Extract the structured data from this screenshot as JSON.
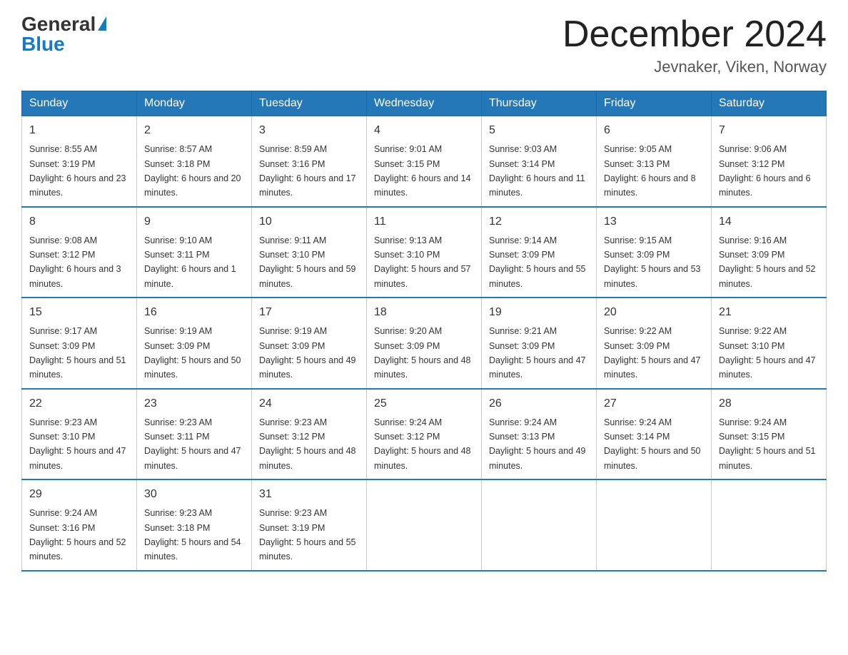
{
  "header": {
    "logo_general": "General",
    "logo_blue": "Blue",
    "month_title": "December 2024",
    "location": "Jevnaker, Viken, Norway"
  },
  "days_of_week": [
    "Sunday",
    "Monday",
    "Tuesday",
    "Wednesday",
    "Thursday",
    "Friday",
    "Saturday"
  ],
  "weeks": [
    [
      {
        "day": "1",
        "sunrise": "8:55 AM",
        "sunset": "3:19 PM",
        "daylight": "6 hours and 23 minutes."
      },
      {
        "day": "2",
        "sunrise": "8:57 AM",
        "sunset": "3:18 PM",
        "daylight": "6 hours and 20 minutes."
      },
      {
        "day": "3",
        "sunrise": "8:59 AM",
        "sunset": "3:16 PM",
        "daylight": "6 hours and 17 minutes."
      },
      {
        "day": "4",
        "sunrise": "9:01 AM",
        "sunset": "3:15 PM",
        "daylight": "6 hours and 14 minutes."
      },
      {
        "day": "5",
        "sunrise": "9:03 AM",
        "sunset": "3:14 PM",
        "daylight": "6 hours and 11 minutes."
      },
      {
        "day": "6",
        "sunrise": "9:05 AM",
        "sunset": "3:13 PM",
        "daylight": "6 hours and 8 minutes."
      },
      {
        "day": "7",
        "sunrise": "9:06 AM",
        "sunset": "3:12 PM",
        "daylight": "6 hours and 6 minutes."
      }
    ],
    [
      {
        "day": "8",
        "sunrise": "9:08 AM",
        "sunset": "3:12 PM",
        "daylight": "6 hours and 3 minutes."
      },
      {
        "day": "9",
        "sunrise": "9:10 AM",
        "sunset": "3:11 PM",
        "daylight": "6 hours and 1 minute."
      },
      {
        "day": "10",
        "sunrise": "9:11 AM",
        "sunset": "3:10 PM",
        "daylight": "5 hours and 59 minutes."
      },
      {
        "day": "11",
        "sunrise": "9:13 AM",
        "sunset": "3:10 PM",
        "daylight": "5 hours and 57 minutes."
      },
      {
        "day": "12",
        "sunrise": "9:14 AM",
        "sunset": "3:09 PM",
        "daylight": "5 hours and 55 minutes."
      },
      {
        "day": "13",
        "sunrise": "9:15 AM",
        "sunset": "3:09 PM",
        "daylight": "5 hours and 53 minutes."
      },
      {
        "day": "14",
        "sunrise": "9:16 AM",
        "sunset": "3:09 PM",
        "daylight": "5 hours and 52 minutes."
      }
    ],
    [
      {
        "day": "15",
        "sunrise": "9:17 AM",
        "sunset": "3:09 PM",
        "daylight": "5 hours and 51 minutes."
      },
      {
        "day": "16",
        "sunrise": "9:19 AM",
        "sunset": "3:09 PM",
        "daylight": "5 hours and 50 minutes."
      },
      {
        "day": "17",
        "sunrise": "9:19 AM",
        "sunset": "3:09 PM",
        "daylight": "5 hours and 49 minutes."
      },
      {
        "day": "18",
        "sunrise": "9:20 AM",
        "sunset": "3:09 PM",
        "daylight": "5 hours and 48 minutes."
      },
      {
        "day": "19",
        "sunrise": "9:21 AM",
        "sunset": "3:09 PM",
        "daylight": "5 hours and 47 minutes."
      },
      {
        "day": "20",
        "sunrise": "9:22 AM",
        "sunset": "3:09 PM",
        "daylight": "5 hours and 47 minutes."
      },
      {
        "day": "21",
        "sunrise": "9:22 AM",
        "sunset": "3:10 PM",
        "daylight": "5 hours and 47 minutes."
      }
    ],
    [
      {
        "day": "22",
        "sunrise": "9:23 AM",
        "sunset": "3:10 PM",
        "daylight": "5 hours and 47 minutes."
      },
      {
        "day": "23",
        "sunrise": "9:23 AM",
        "sunset": "3:11 PM",
        "daylight": "5 hours and 47 minutes."
      },
      {
        "day": "24",
        "sunrise": "9:23 AM",
        "sunset": "3:12 PM",
        "daylight": "5 hours and 48 minutes."
      },
      {
        "day": "25",
        "sunrise": "9:24 AM",
        "sunset": "3:12 PM",
        "daylight": "5 hours and 48 minutes."
      },
      {
        "day": "26",
        "sunrise": "9:24 AM",
        "sunset": "3:13 PM",
        "daylight": "5 hours and 49 minutes."
      },
      {
        "day": "27",
        "sunrise": "9:24 AM",
        "sunset": "3:14 PM",
        "daylight": "5 hours and 50 minutes."
      },
      {
        "day": "28",
        "sunrise": "9:24 AM",
        "sunset": "3:15 PM",
        "daylight": "5 hours and 51 minutes."
      }
    ],
    [
      {
        "day": "29",
        "sunrise": "9:24 AM",
        "sunset": "3:16 PM",
        "daylight": "5 hours and 52 minutes."
      },
      {
        "day": "30",
        "sunrise": "9:23 AM",
        "sunset": "3:18 PM",
        "daylight": "5 hours and 54 minutes."
      },
      {
        "day": "31",
        "sunrise": "9:23 AM",
        "sunset": "3:19 PM",
        "daylight": "5 hours and 55 minutes."
      },
      null,
      null,
      null,
      null
    ]
  ],
  "labels": {
    "sunrise": "Sunrise: ",
    "sunset": "Sunset: ",
    "daylight": "Daylight: "
  }
}
